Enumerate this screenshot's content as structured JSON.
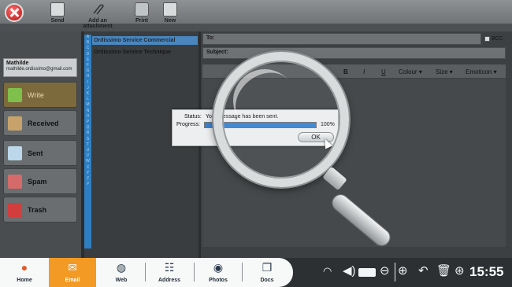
{
  "toolbar": {
    "send_label": "Send",
    "attach_label": "Add an attachment",
    "print_label": "Print",
    "new_label": "New"
  },
  "account": {
    "name": "Mathilde",
    "email": "mathilde.ordissimo@gmail.com"
  },
  "folders": [
    {
      "label": "Write",
      "icon": "pencil-icon",
      "active": true
    },
    {
      "label": "Received",
      "icon": "inbox-icon"
    },
    {
      "label": "Sent",
      "icon": "sent-icon"
    },
    {
      "label": "Spam",
      "icon": "spam-icon"
    },
    {
      "label": "Trash",
      "icon": "trash-icon"
    }
  ],
  "alphabet": [
    "A",
    "B",
    "C",
    "D",
    "E",
    "F",
    "G",
    "H",
    "I",
    "J",
    "K",
    "L",
    "M",
    "N",
    "O",
    "P",
    "Q",
    "R",
    "S",
    "T",
    "U",
    "V",
    "W",
    "X",
    "Y",
    "Z",
    "#"
  ],
  "contacts": [
    "Ordissimo Service Commercial",
    "Ordissimo Service Technique"
  ],
  "compose": {
    "to_label": "To:",
    "subject_label": "Subject:",
    "bcc_label": "BCC",
    "format": {
      "bold": "B",
      "italic": "I",
      "underline": "U",
      "colour": "Colour",
      "size": "Size",
      "emoticon": "Emoticon"
    }
  },
  "dialog": {
    "status_label": "Status:",
    "status_value": "Your message has been sent.",
    "progress_label": "Progress:",
    "progress_value": "100%",
    "progress_fraction": 1.0,
    "ok_label": "OK"
  },
  "taskbar": {
    "apps": [
      {
        "label": "Home",
        "icon": "home-icon"
      },
      {
        "label": "Email",
        "icon": "email-icon",
        "active": true
      },
      {
        "label": "Web",
        "icon": "globe-icon"
      },
      {
        "label": "Address",
        "icon": "address-book-icon"
      },
      {
        "label": "Photos",
        "icon": "camera-icon"
      },
      {
        "label": "Docs",
        "icon": "documents-icon"
      }
    ],
    "clock": "15:55"
  },
  "colors": {
    "accent": "#f39a25",
    "selection": "#4a86bd",
    "progress": "#3a83cf"
  }
}
